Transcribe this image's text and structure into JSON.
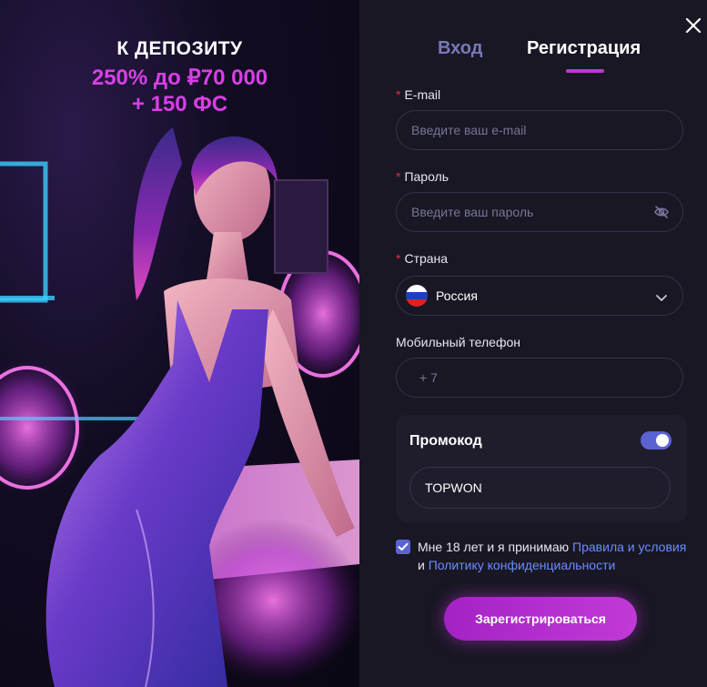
{
  "promo": {
    "title": "К ДЕПОЗИТУ",
    "bonus_line1": "250% до ₽70 000",
    "bonus_line2": "+ 150 ФС"
  },
  "tabs": {
    "login": "Вход",
    "register": "Регистрация",
    "active": "register"
  },
  "form": {
    "email": {
      "label": "E-mail",
      "required": "*",
      "placeholder": "Введите ваш e-mail"
    },
    "password": {
      "label": "Пароль",
      "required": "*",
      "placeholder": "Введите ваш пароль"
    },
    "country": {
      "label": "Страна",
      "required": "*",
      "value": "Россия"
    },
    "phone": {
      "label": "Мобильный телефон",
      "prefix": "+ 7"
    },
    "promo_code": {
      "label": "Промокод",
      "enabled": true,
      "value": "TOPWON"
    },
    "agreement": {
      "checked": true,
      "text_before": "Мне 18 лет и я принимаю ",
      "rules_link": "Правила и условия",
      "text_middle": " и ",
      "privacy_link": "Политику конфиденциальности"
    },
    "submit_label": "Зарегистрироваться"
  },
  "colors": {
    "accent": "#c235d4",
    "link": "#6b8cff",
    "toggle": "#5b63d3",
    "panel_bg": "#191723",
    "required": "#e02c4a"
  },
  "icons": {
    "close": "close-icon",
    "eye_off": "eye-off-icon",
    "chevron": "chevron-down-icon",
    "flag": "russia-flag-icon",
    "check": "check-icon"
  }
}
